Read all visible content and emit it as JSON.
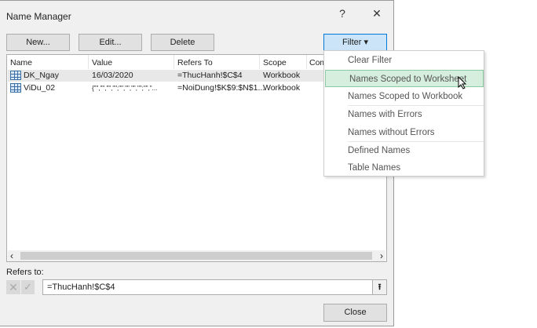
{
  "window": {
    "title": "Name Manager",
    "help": "?",
    "close": "✕"
  },
  "toolbar": {
    "new": "New...",
    "edit": "Edit...",
    "delete": "Delete",
    "filter": "Filter ▾"
  },
  "columns": [
    "Name",
    "Value",
    "Refers To",
    "Scope",
    "Com"
  ],
  "rows": [
    {
      "name": "DK_Ngay",
      "value": "16/03/2020",
      "refers_to": "=ThucHanh!$C$4",
      "scope": "Workbook"
    },
    {
      "name": "ViDu_02",
      "value": "{\"\",\"\",\"\",\"\";\"\",\"\",\"\",\"\";\"\",\"...",
      "refers_to": "=NoiDung!$K$9:$N$1...",
      "scope": "Workbook"
    }
  ],
  "scroll": {
    "left": "‹",
    "right": "›"
  },
  "refers": {
    "label": "Refers to:",
    "value": "=ThucHanh!$C$4",
    "cancel": "✕",
    "confirm": "✓",
    "collapse": "⭱"
  },
  "close_button": "Close",
  "filter_menu": {
    "items": [
      "Clear Filter",
      "Names Scoped to Worksheet",
      "Names Scoped to Workbook",
      "Names with Errors",
      "Names without Errors",
      "Defined Names",
      "Table Names"
    ],
    "highlighted": "Names Scoped to Worksheet",
    "highlight_color": "#d5eedd"
  }
}
